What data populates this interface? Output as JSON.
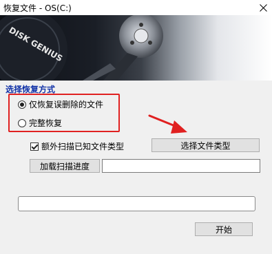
{
  "window": {
    "title": "恢复文件 - OS(C:)",
    "close_icon": "close-icon"
  },
  "banner": {
    "logo_text": "DISK GENIUS"
  },
  "recovery_mode": {
    "group_title": "选择恢复方式",
    "options": [
      {
        "label": "仅恢复误删除的文件",
        "checked": true
      },
      {
        "label": "完整恢复",
        "checked": false
      }
    ],
    "highlight_color": "#e02020",
    "arrow_color": "#e02020"
  },
  "file_types": {
    "checkbox_label": "额外扫描已知文件类型",
    "checked": true,
    "select_button_label": "选择文件类型"
  },
  "progress": {
    "load_button_label": "加载扫描进度",
    "path_value": ""
  },
  "status": {
    "value": ""
  },
  "actions": {
    "start_label": "开始"
  },
  "colors": {
    "group_title": "#1233a8",
    "background": "#f0f0f0"
  }
}
